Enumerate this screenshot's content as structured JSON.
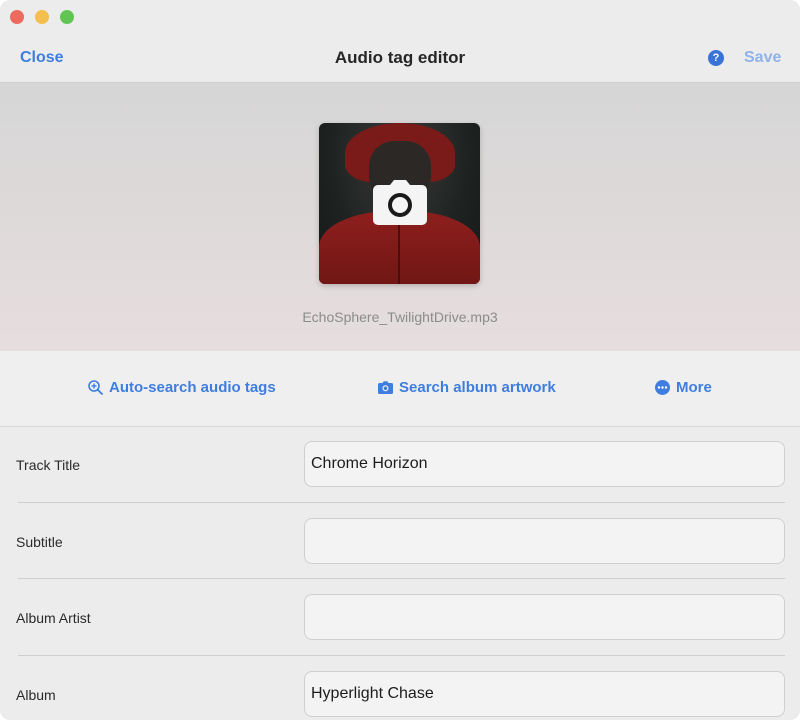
{
  "window": {
    "title": "Audio tag editor",
    "close_label": "Close",
    "save_label": "Save",
    "help_glyph": "?"
  },
  "artwork": {
    "filename": "EchoSphere_TwilightDrive.mp3",
    "overlay_icon": "camera-icon"
  },
  "actions": {
    "auto_search_label": "Auto-search audio tags",
    "auto_search_icon": "magnify-plus-icon",
    "artwork_search_label": "Search album artwork",
    "artwork_search_icon": "camera-icon",
    "more_label": "More",
    "more_icon": "ellipsis-circle-icon"
  },
  "fields": [
    {
      "label": "Track Title",
      "value": "Chrome Horizon"
    },
    {
      "label": "Subtitle",
      "value": ""
    },
    {
      "label": "Album Artist",
      "value": ""
    },
    {
      "label": "Album",
      "value": "Hyperlight Chase"
    }
  ],
  "colors": {
    "accent": "#3f7ee0",
    "save_disabled": "#8fb2ea",
    "help": "#3a73d8"
  }
}
